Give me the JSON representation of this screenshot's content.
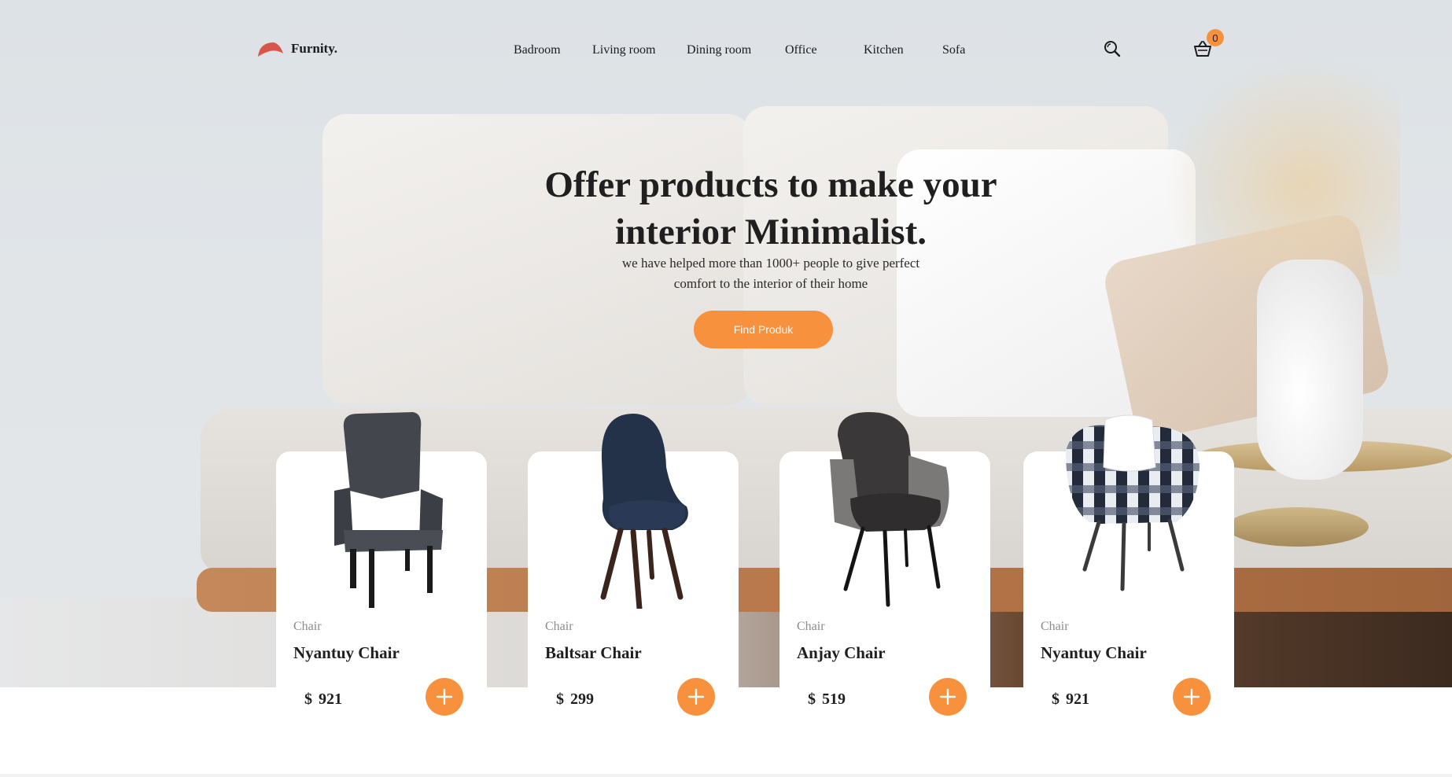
{
  "brand": {
    "name": "Furnity.",
    "accent": "#f7913d",
    "logo_color": "#d9544a"
  },
  "nav": {
    "items": [
      {
        "label": "Badroom"
      },
      {
        "label": "Living room"
      },
      {
        "label": "Dining room"
      },
      {
        "label": "Office"
      },
      {
        "label": "Kitchen"
      },
      {
        "label": "Sofa"
      }
    ],
    "search_icon": "search-icon",
    "cart_icon": "basket-icon",
    "cart_count": "0"
  },
  "hero": {
    "headline_line1": "Offer products to make your",
    "headline_line2": "interior Minimalist.",
    "sub_line1": "we have helped more than 1000+ people to give perfect",
    "sub_line2": "comfort to the interior of their home",
    "cta_label": "Find Produk"
  },
  "products": [
    {
      "category": "Chair",
      "name": "Nyantuy Chair",
      "currency": "$",
      "price": "921",
      "color": "#43464d"
    },
    {
      "category": "Chair",
      "name": "Baltsar Chair",
      "currency": "$",
      "price": "299",
      "color": "#233149"
    },
    {
      "category": "Chair",
      "name": "Anjay Chair",
      "currency": "$",
      "price": "519",
      "color": "#3a3838"
    },
    {
      "category": "Chair",
      "name": "Nyantuy Chair",
      "currency": "$",
      "price": "921",
      "color": "#232a3a"
    }
  ]
}
